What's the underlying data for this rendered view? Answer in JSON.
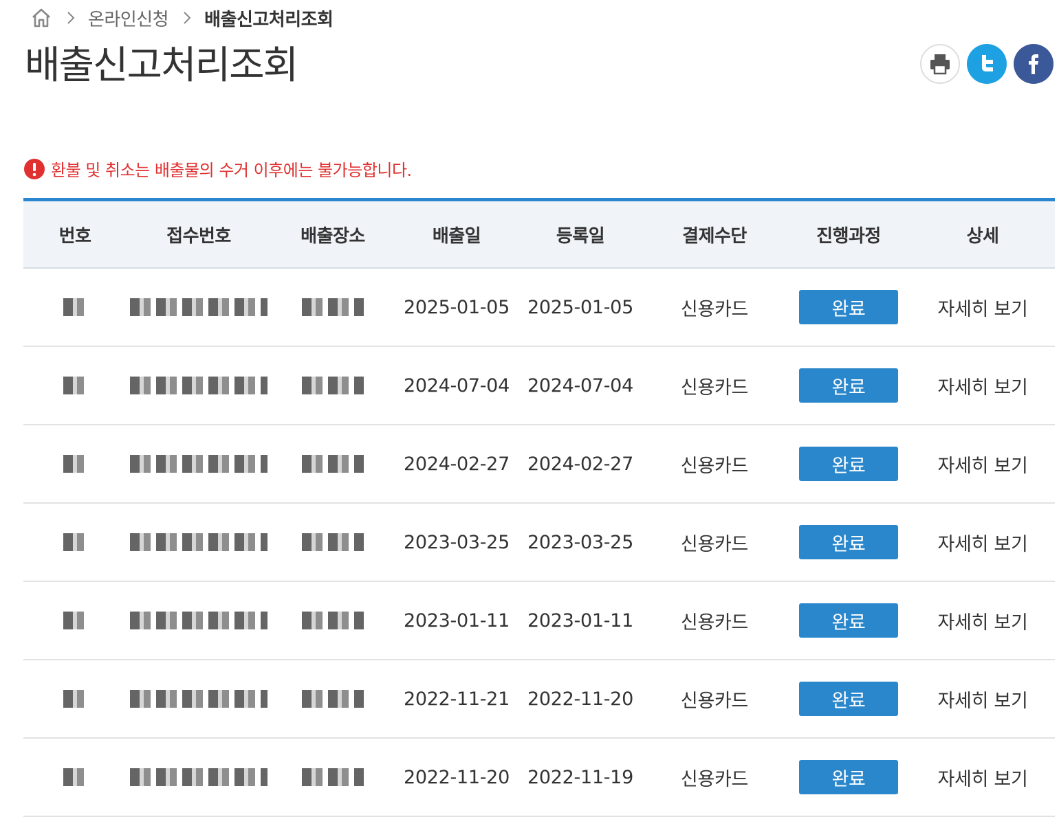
{
  "breadcrumb": {
    "home_icon": "home-icon",
    "items": [
      "온라인신청",
      "배출신고처리조회"
    ]
  },
  "page_title": "배출신고처리조회",
  "share": {
    "icons": [
      "print-icon",
      "twitter-icon",
      "facebook-icon"
    ],
    "colors": {
      "twitter": "#1da1e2",
      "facebook": "#3b5998"
    }
  },
  "notice": {
    "icon": "alert-icon",
    "text": "환불 및 취소는 배출물의 수거 이후에는 불가능합니다.",
    "color": "#e03030"
  },
  "table": {
    "accent_color": "#2a86cf",
    "columns": [
      "번호",
      "접수번호",
      "배출장소",
      "배출일",
      "등록일",
      "결제수단",
      "진행과정",
      "상세"
    ],
    "rows": [
      {
        "disposal_date": "2025-01-05",
        "reg_date": "2025-01-05",
        "payment": "신용카드",
        "status": "완료",
        "detail": "자세히 보기"
      },
      {
        "disposal_date": "2024-07-04",
        "reg_date": "2024-07-04",
        "payment": "신용카드",
        "status": "완료",
        "detail": "자세히 보기"
      },
      {
        "disposal_date": "2024-02-27",
        "reg_date": "2024-02-27",
        "payment": "신용카드",
        "status": "완료",
        "detail": "자세히 보기"
      },
      {
        "disposal_date": "2023-03-25",
        "reg_date": "2023-03-25",
        "payment": "신용카드",
        "status": "완료",
        "detail": "자세히 보기"
      },
      {
        "disposal_date": "2023-01-11",
        "reg_date": "2023-01-11",
        "payment": "신용카드",
        "status": "완료",
        "detail": "자세히 보기"
      },
      {
        "disposal_date": "2022-11-21",
        "reg_date": "2022-11-20",
        "payment": "신용카드",
        "status": "완료",
        "detail": "자세히 보기"
      },
      {
        "disposal_date": "2022-11-20",
        "reg_date": "2022-11-19",
        "payment": "신용카드",
        "status": "완료",
        "detail": "자세히 보기"
      }
    ]
  }
}
